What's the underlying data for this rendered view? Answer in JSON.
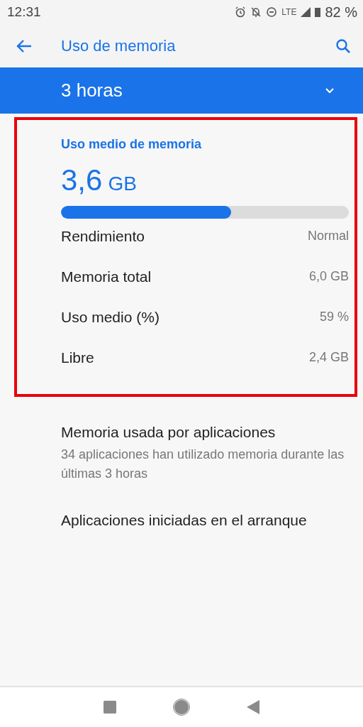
{
  "status_bar": {
    "time": "12:31",
    "network": "LTE",
    "battery": "82 %"
  },
  "toolbar": {
    "title": "Uso de memoria"
  },
  "period_selector": {
    "value": "3 horas"
  },
  "summary": {
    "title": "Uso medio de memoria",
    "value": "3,6",
    "unit": "GB",
    "level": 0.59,
    "rows": [
      {
        "label": "Rendimiento",
        "value": "Normal"
      },
      {
        "label": "Memoria total",
        "value": "6,0 GB"
      },
      {
        "label": "Uso medio (%)",
        "value": "59 %"
      },
      {
        "label": "Libre",
        "value": "2,4 GB"
      }
    ]
  },
  "items": [
    {
      "title": "Memoria usada por aplicaciones",
      "subtitle": "34 aplicaciones han utilizado memoria durante las últimas 3 horas"
    },
    {
      "title": "Aplicaciones iniciadas en el arranque"
    }
  ]
}
